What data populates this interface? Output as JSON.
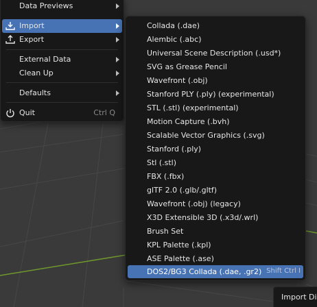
{
  "file_menu": {
    "items": [
      {
        "label": "Data Previews",
        "icon": "none",
        "arrow": true
      },
      {
        "label": "Import",
        "icon": "import-icon",
        "arrow": true,
        "active": true
      },
      {
        "label": "Export",
        "icon": "export-icon",
        "arrow": true
      },
      {
        "label": "External Data",
        "icon": "none",
        "arrow": true
      },
      {
        "label": "Clean Up",
        "icon": "none",
        "arrow": true
      },
      {
        "label": "Defaults",
        "icon": "none",
        "arrow": true
      },
      {
        "label": "Quit",
        "icon": "power-icon",
        "shortcut": "Ctrl Q"
      }
    ]
  },
  "import_menu": {
    "items": [
      {
        "label": "Collada (.dae)"
      },
      {
        "label": "Alembic (.abc)"
      },
      {
        "label": "Universal Scene Description (.usd*)"
      },
      {
        "label": "SVG as Grease Pencil"
      },
      {
        "label": "Wavefront (.obj)"
      },
      {
        "label": "Stanford PLY (.ply) (experimental)"
      },
      {
        "label": "STL (.stl) (experimental)"
      },
      {
        "label": "Motion Capture (.bvh)"
      },
      {
        "label": "Scalable Vector Graphics (.svg)"
      },
      {
        "label": "Stanford (.ply)"
      },
      {
        "label": "Stl (.stl)"
      },
      {
        "label": "FBX (.fbx)"
      },
      {
        "label": "glTF 2.0 (.glb/.gltf)"
      },
      {
        "label": "Wavefront (.obj) (legacy)"
      },
      {
        "label": "X3D Extensible 3D (.x3d/.wrl)"
      },
      {
        "label": "Brush Set"
      },
      {
        "label": "KPL Palette (.kpl)"
      },
      {
        "label": "ASE Palette (.ase)"
      },
      {
        "label": "DOS2/BG3 Collada (.dae, .gr2)",
        "shortcut": "Shift Ctrl I",
        "active": true
      }
    ]
  },
  "bottom_panel": {
    "label": "Import Div"
  },
  "colors": {
    "menu_bg": "#181818",
    "highlight": "#4772b3",
    "viewport_bg": "#3a3a3a",
    "grid_line": "#4a4a4a",
    "axis_y_green": "#6f9a2b"
  }
}
